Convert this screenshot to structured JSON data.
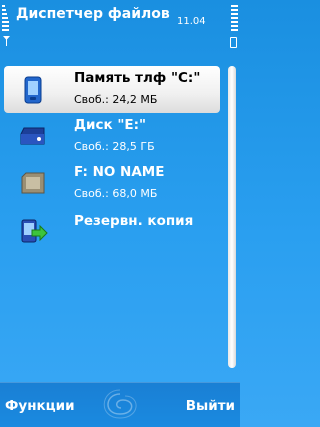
{
  "status": {
    "title": "Диспетчер файлов",
    "time": "11.04"
  },
  "drives": [
    {
      "name": "Память тлф \"C:\"",
      "free": "Своб.: 24,2 МБ",
      "icon": "phone-memory-icon",
      "selected": true
    },
    {
      "name": "Диск \"E:\"",
      "free": "Своб.: 28,5 ГБ",
      "icon": "mass-storage-icon",
      "selected": false
    },
    {
      "name": "F: NO NAME",
      "free": "Своб.: 68,0 МБ",
      "icon": "memory-card-icon",
      "selected": false
    },
    {
      "name": "Резервн. копия",
      "icon": "backup-icon",
      "selected": false
    }
  ],
  "softkeys": {
    "left": "Функции",
    "right": "Выйти"
  },
  "colors": {
    "background": "#2a9ff0",
    "highlight": "#ffffff",
    "softbar": "#1a86dc"
  }
}
